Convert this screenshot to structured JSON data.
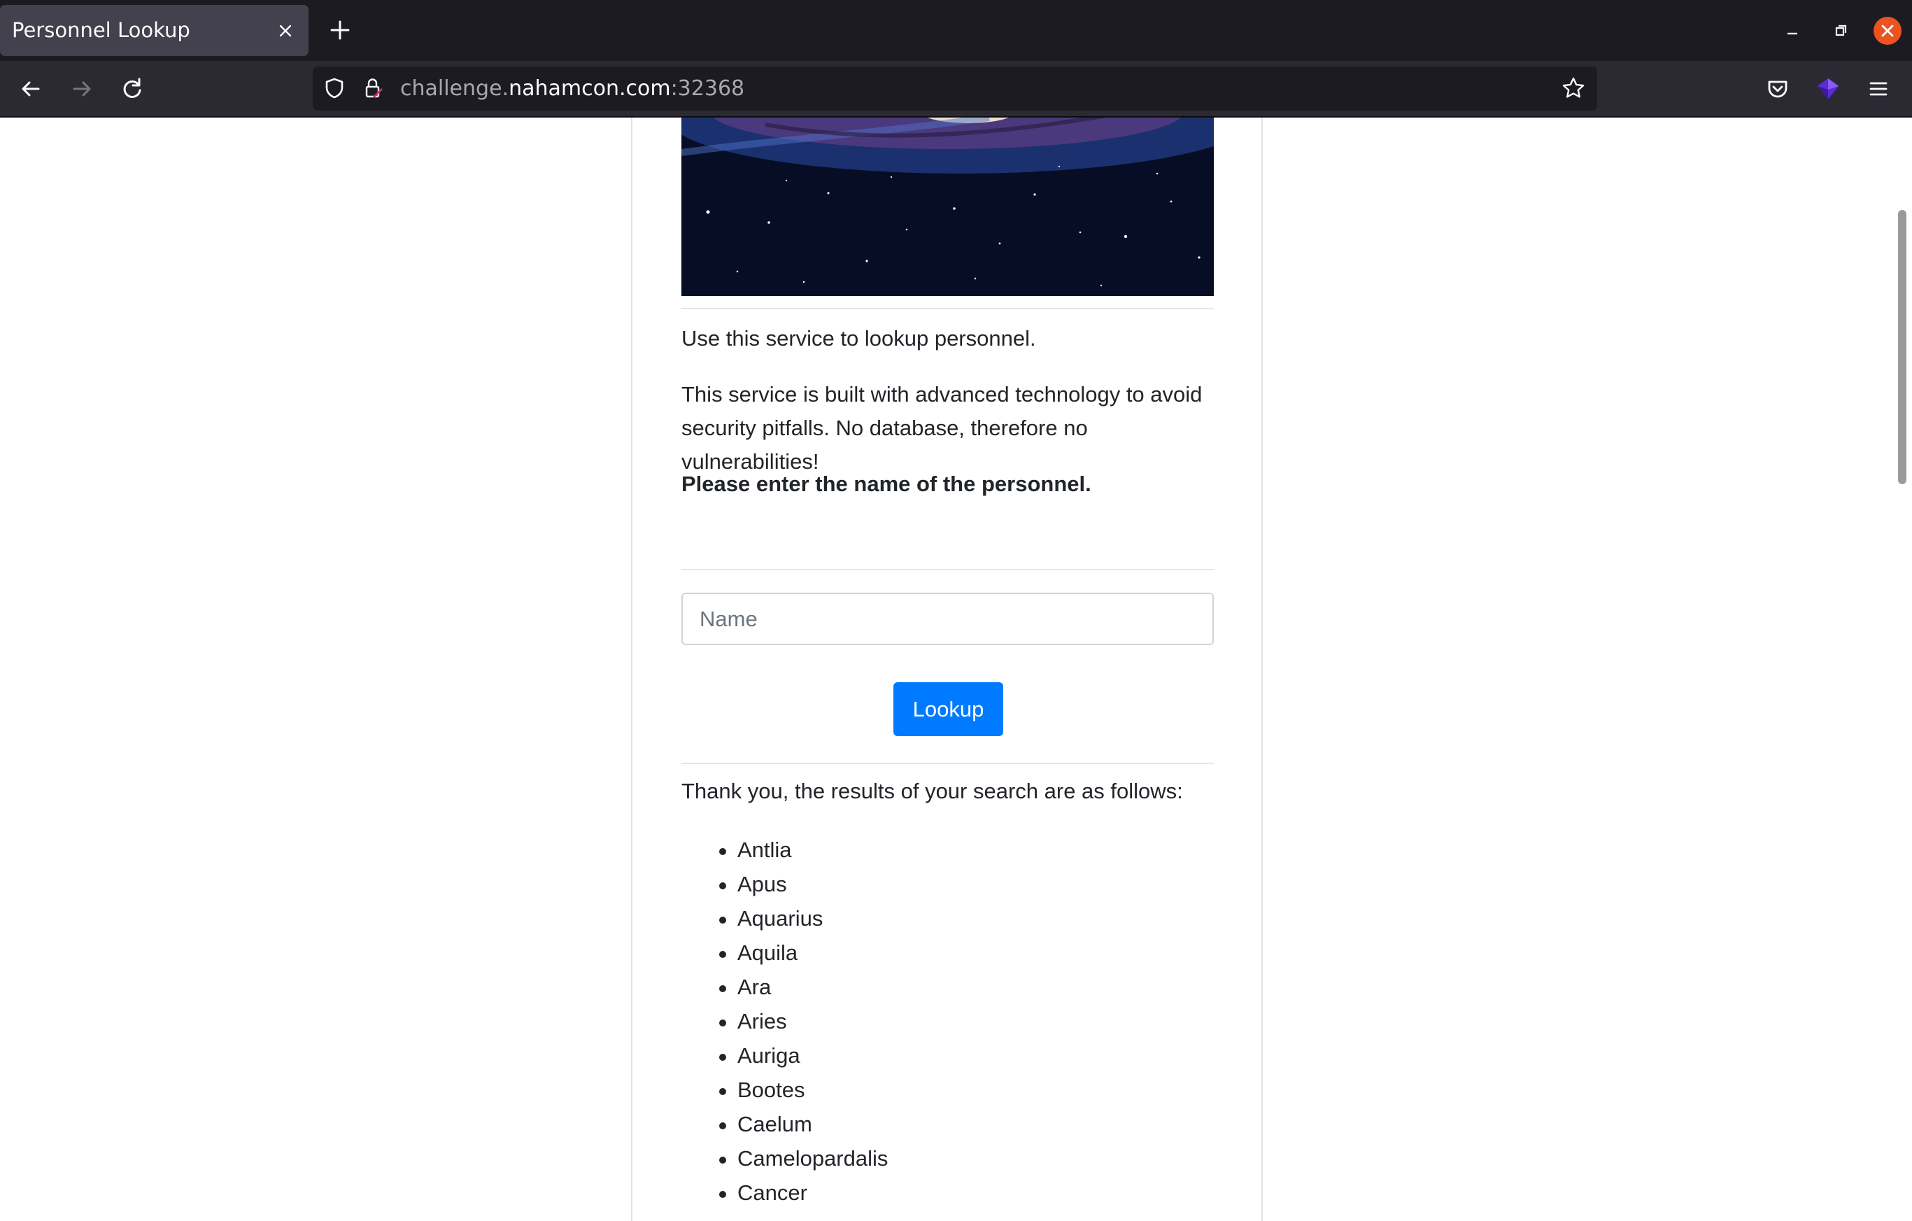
{
  "browser": {
    "tab_title": "Personnel Lookup",
    "url_prefix": "challenge.",
    "url_host": "nahamcon.com",
    "url_port": ":32368"
  },
  "page": {
    "intro": "Use this service to lookup personnel.",
    "description": "This service is built with advanced technology to avoid security pitfalls. No database, therefore no vulnerabilities!",
    "prompt": "Please enter the name of the personnel.",
    "name_placeholder": "Name",
    "name_value": "",
    "lookup_label": "Lookup",
    "results_heading": "Thank you, the results of your search are as follows:",
    "results": [
      "Antlia",
      "Apus",
      "Aquarius",
      "Aquila",
      "Ara",
      "Aries",
      "Auriga",
      "Bootes",
      "Caelum",
      "Camelopardalis",
      "Cancer"
    ]
  },
  "colors": {
    "accent": "#007bff",
    "window_close": "#e95420",
    "chrome_dark": "#1c1b22",
    "toolbar": "#2b2a33"
  },
  "icons": [
    "shield-icon",
    "lock-icon",
    "star-icon",
    "pocket-icon",
    "extension-icon",
    "menu-icon",
    "back-icon",
    "forward-icon",
    "reload-icon",
    "close-icon",
    "plus-icon"
  ]
}
